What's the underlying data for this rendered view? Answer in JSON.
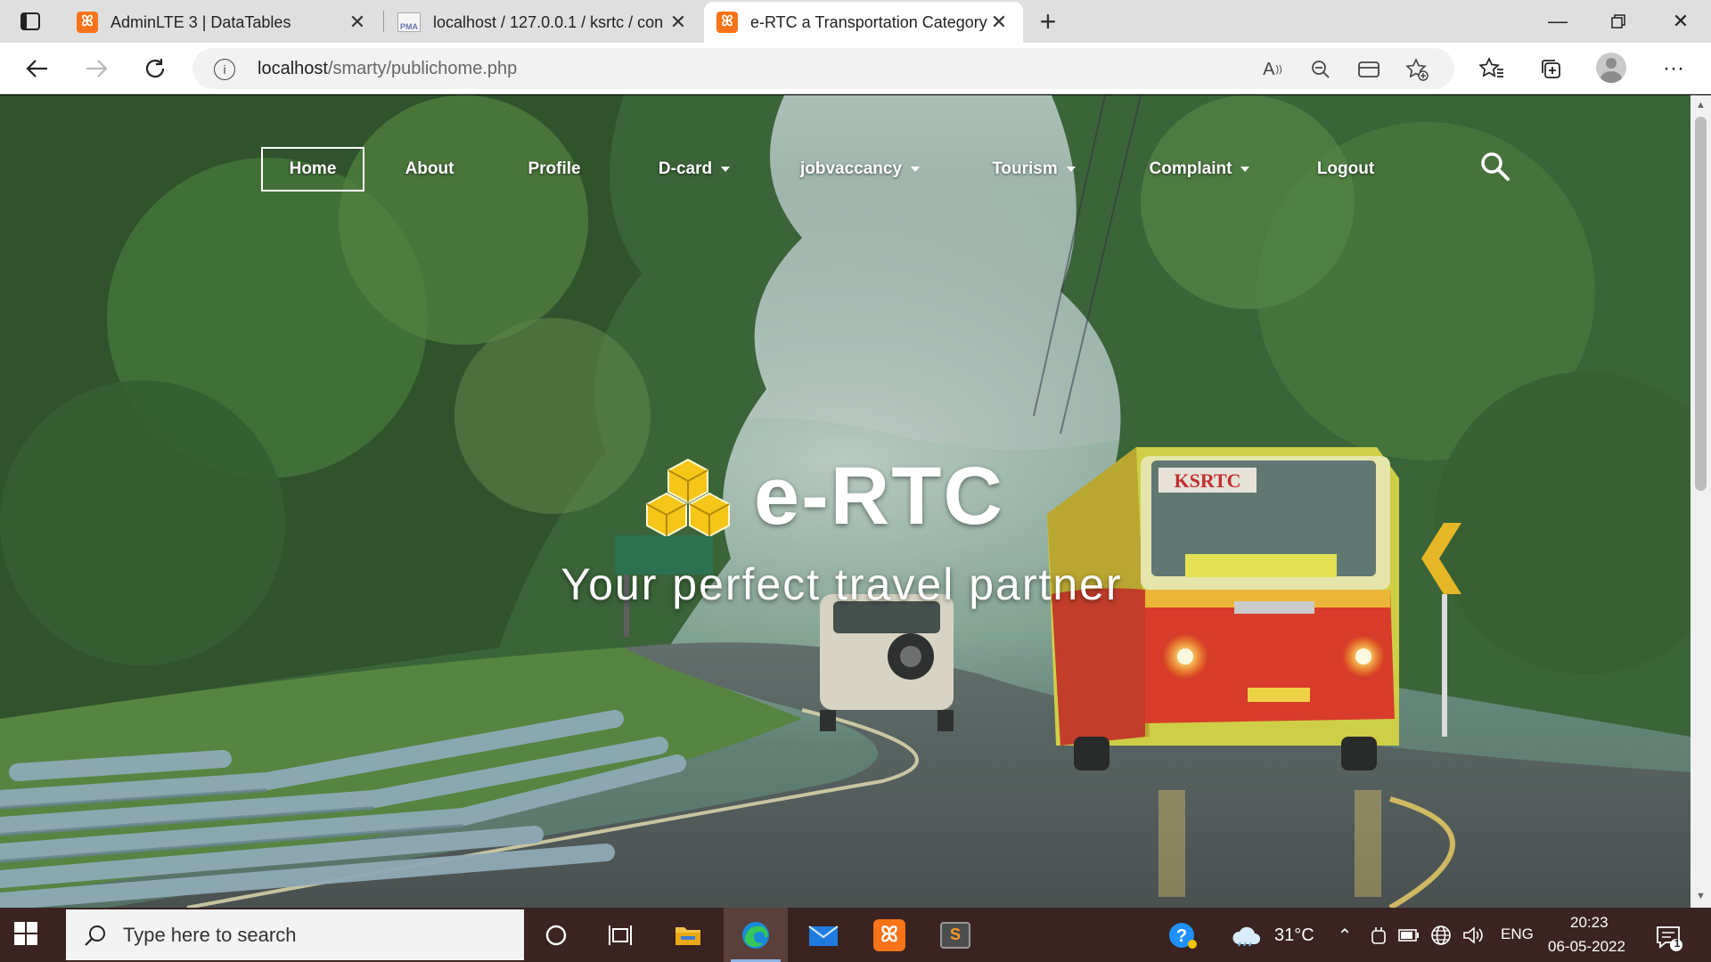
{
  "browser": {
    "tabs": [
      {
        "title": "AdminLTE 3 | DataTables",
        "favicon": "xampp-icon"
      },
      {
        "title": "localhost / 127.0.0.1 / ksrtc / con",
        "favicon": "phpmyadmin-icon"
      },
      {
        "title": "e-RTC a Transportation Category",
        "favicon": "xampp-icon",
        "active": true
      }
    ],
    "url_host": "localhost",
    "url_path": "/smarty/publichome.php"
  },
  "nav": {
    "items": [
      {
        "label": "Home",
        "active": true
      },
      {
        "label": "About"
      },
      {
        "label": "Profile"
      },
      {
        "label": "D-card",
        "dropdown": true
      },
      {
        "label": "jobvaccancy",
        "dropdown": true
      },
      {
        "label": "Tourism",
        "dropdown": true
      },
      {
        "label": "Complaint",
        "dropdown": true
      },
      {
        "label": "Logout"
      }
    ]
  },
  "hero": {
    "title": "e-RTC",
    "tagline": "Your perfect travel partner",
    "bus_sign": "KSRTC",
    "accent": "#f5c518"
  },
  "taskbar": {
    "search_placeholder": "Type here to search",
    "weather": "31°C",
    "language": "ENG",
    "time": "20:23",
    "date": "06-05-2022",
    "notification_count": "1"
  }
}
